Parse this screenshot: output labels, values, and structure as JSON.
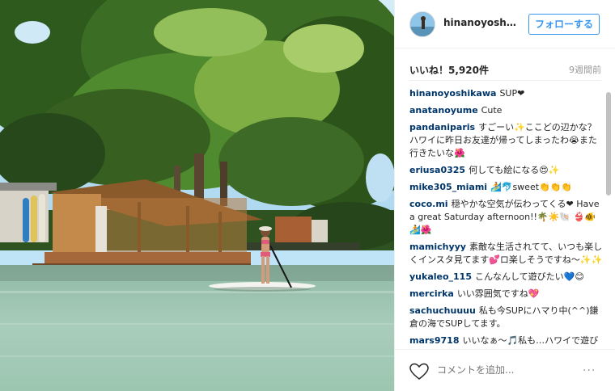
{
  "post": {
    "username": "hinanoyoshika...",
    "follow_label": "フォローする",
    "likes_text": "いいね！5,920件",
    "time_text": "9週間前",
    "add_comment_placeholder": "コメントを追加...",
    "more_label": "···"
  },
  "comments": [
    {
      "user": "hinanoyoshikawa",
      "text": "SUP❤"
    },
    {
      "user": "anatanoyume",
      "text": "Cute"
    },
    {
      "user": "pandaniparis",
      "text": "すごーい✨ここどの辺かな？ハワイに昨日お友達が帰ってしまったわ😭また行きたいな🌺"
    },
    {
      "user": "eriusa0325",
      "text": "何しても絵になる😍✨"
    },
    {
      "user": "mike305_miami",
      "text": "🏄🐬sweet👏👏👏"
    },
    {
      "user": "coco.mi",
      "text": "穏やかな空気が伝わってくる❤ Have a great Saturday afternoon!!🌴☀️🐚 👙🐠🏄🌺"
    },
    {
      "user": "mamichyyy",
      "text": "素敵な生活されてて、いつも楽しくインスタ見てます💕ロ楽しそうですね〜✨✨"
    },
    {
      "user": "yukaleo_115",
      "text": "こんなんして遊びたい💙😊"
    },
    {
      "user": "mercirka",
      "text": "いい雰囲気ですね💖"
    },
    {
      "user": "sachuchuuuu",
      "text": "私も今SUPにハマり中(^^)鎌倉の海でSUPしてます。"
    },
    {
      "user": "mars9718",
      "text": "いいなぁ〜🎵私も…ハワイで遊びたい〜🌺"
    }
  ],
  "icons": {
    "heart": "heart-outline-icon",
    "more": "more-options-icon"
  },
  "colors": {
    "accent": "#3897f0",
    "username": "#003569",
    "muted": "#999999"
  }
}
